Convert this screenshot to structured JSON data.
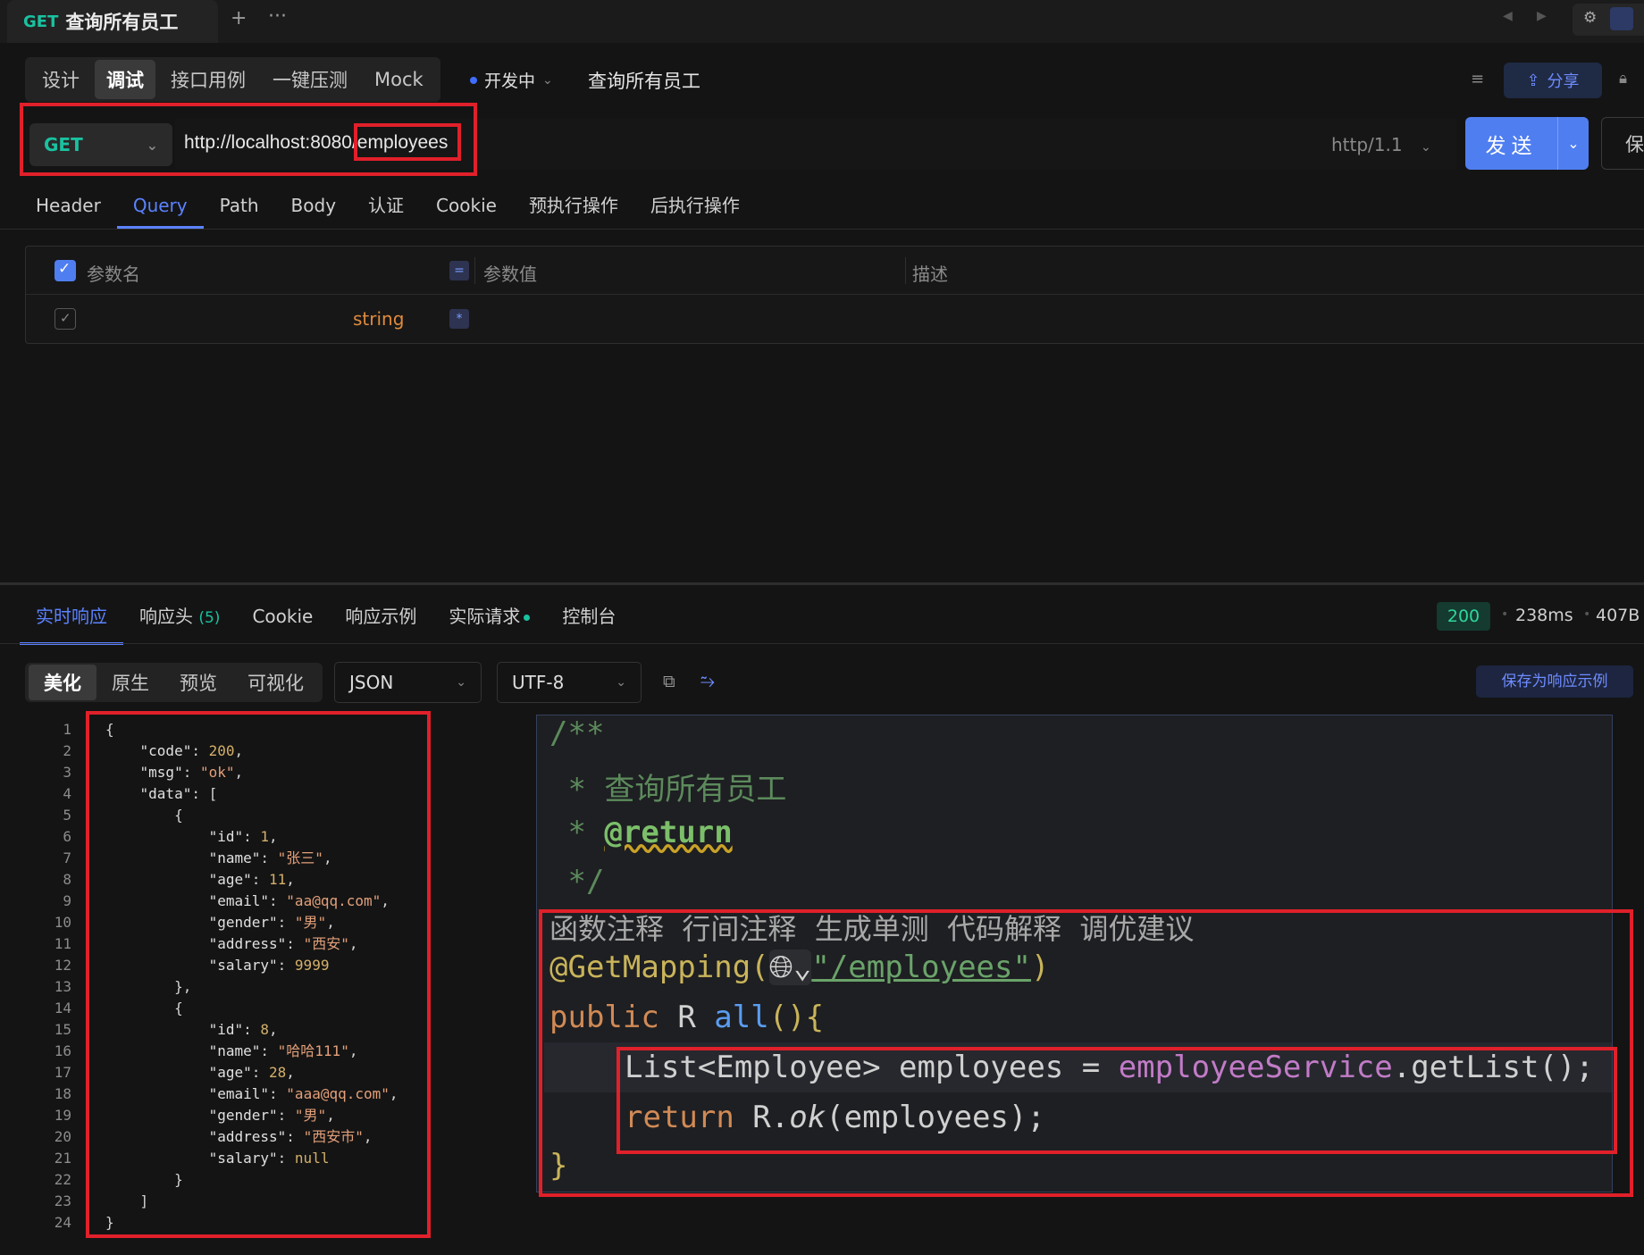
{
  "tab": {
    "method": "GET",
    "title": "查询所有员工"
  },
  "mode_tabs": [
    "设计",
    "调试",
    "接口用例",
    "一键压测",
    "Mock"
  ],
  "status": "开发中",
  "api_name": "查询所有员工",
  "share": "分享",
  "request": {
    "method": "GET",
    "url": "http://localhost:8080/employees",
    "http_version": "http/1.1",
    "send": "发送",
    "save": "保"
  },
  "request_tabs": [
    "Header",
    "Query",
    "Path",
    "Body",
    "认证",
    "Cookie",
    "预执行操作",
    "后执行操作"
  ],
  "params": {
    "col_name": "参数名",
    "col_value": "参数值",
    "col_desc": "描述",
    "row_type": "string"
  },
  "response_tabs": [
    "实时响应",
    "响应头",
    "Cookie",
    "响应示例",
    "实际请求",
    "控制台"
  ],
  "response_header_count": "(5)",
  "response": {
    "status": "200",
    "time": "238ms",
    "size": "407B"
  },
  "view_modes": [
    "美化",
    "原生",
    "预览",
    "可视化"
  ],
  "format": "JSON",
  "encoding": "UTF-8",
  "save_example": "保存为响应示例",
  "json_lines": [
    "{",
    "    \"code\": 200,",
    "    \"msg\": \"ok\",",
    "    \"data\": [",
    "        {",
    "            \"id\": 1,",
    "            \"name\": \"张三\",",
    "            \"age\": 11,",
    "            \"email\": \"aa@qq.com\",",
    "            \"gender\": \"男\",",
    "            \"address\": \"西安\",",
    "            \"salary\": 9999",
    "        },",
    "        {",
    "            \"id\": 8,",
    "            \"name\": \"哈哈111\",",
    "            \"age\": 28,",
    "            \"email\": \"aaa@qq.com\",",
    "            \"gender\": \"男\",",
    "            \"address\": \"西安市\",",
    "            \"salary\": null",
    "        }",
    "    ]",
    "}"
  ],
  "code": {
    "doc_open": "/**",
    "doc_line": " * 查询所有员工",
    "doc_star": " * ",
    "doc_tag": "@return",
    "doc_close": " */",
    "hints": "函数注释  行间注释  生成单测  代码解释  调优建议",
    "annotation": "@GetMapping(",
    "path": "\"/employees\"",
    "paren_close": ")",
    "signature_kw": "public",
    "signature_type": "R",
    "signature_fn": "all",
    "signature_rest": "(){",
    "line_list": "List<Employee> employees = ",
    "line_service": "employeeService",
    "line_call": ".getList();",
    "line_return_kw": "return",
    "line_return_rest": " R.",
    "line_ok": "ok",
    "line_return_end": "(employees);",
    "close_brace": "}"
  }
}
